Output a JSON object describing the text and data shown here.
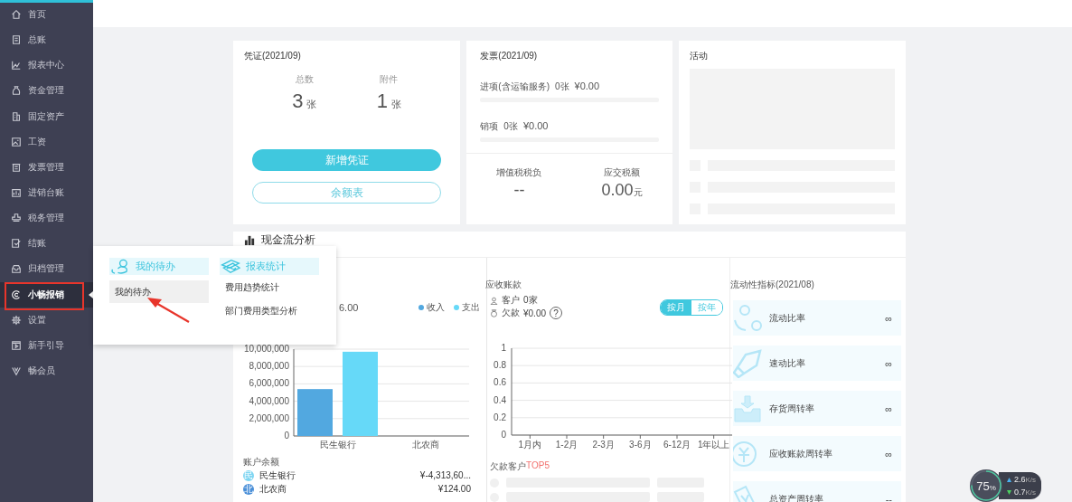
{
  "sidebar": {
    "items": [
      {
        "label": "首页",
        "selected": false
      },
      {
        "label": "总账",
        "selected": false
      },
      {
        "label": "报表中心",
        "selected": false
      },
      {
        "label": "资金管理",
        "selected": false
      },
      {
        "label": "固定资产",
        "selected": false
      },
      {
        "label": "工资",
        "selected": false
      },
      {
        "label": "发票管理",
        "selected": false
      },
      {
        "label": "进销台账",
        "selected": false
      },
      {
        "label": "税务管理",
        "selected": false
      },
      {
        "label": "结账",
        "selected": false
      },
      {
        "label": "归档管理",
        "selected": false
      },
      {
        "label": "小畅报销",
        "selected": true
      },
      {
        "label": "设置",
        "selected": false
      },
      {
        "label": "新手引导",
        "selected": false
      },
      {
        "label": "畅会员",
        "selected": false
      }
    ]
  },
  "popup": {
    "columns": [
      {
        "title": "我的待办",
        "items": [
          {
            "label": "我的待办",
            "selected": true
          }
        ]
      },
      {
        "title": "报表统计",
        "items": [
          {
            "label": "费用趋势统计",
            "selected": false
          },
          {
            "label": "部门费用类型分析",
            "selected": false
          }
        ]
      }
    ]
  },
  "voucher_card": {
    "title": "凭证(2021/09)",
    "stats": [
      {
        "label": "总数",
        "value": "3",
        "unit": "张"
      },
      {
        "label": "附件",
        "value": "1",
        "unit": "张"
      }
    ],
    "primary_button": "新增凭证",
    "secondary_button": "余额表"
  },
  "invoice_card": {
    "title": "发票(2021/09)",
    "lines": [
      {
        "label": "进项(含运输服务)",
        "count": "0张",
        "amount": "¥0.00",
        "level": 0
      },
      {
        "label": "销项",
        "count": "0张",
        "amount": "¥0.00",
        "level": 0
      }
    ],
    "taxes": [
      {
        "label": "增值税税负",
        "value": "--"
      },
      {
        "label": "应交税额",
        "value": "0.00",
        "unit": "元"
      }
    ]
  },
  "activity_card": {
    "title": "活动"
  },
  "cash_flow": {
    "title": "现金流分析",
    "total_fragment": "6.00",
    "chart_data": {
      "type": "bar",
      "grid": true,
      "categories": [
        "民生银行",
        "北农商"
      ],
      "series": [
        {
          "name": "收入",
          "color": "#52a8e0",
          "values": [
            5400000,
            0
          ]
        },
        {
          "name": "支出",
          "color": "#66d9f8",
          "values": [
            9700000,
            0
          ]
        }
      ],
      "ylim": [
        0,
        10000000
      ],
      "yticks": [
        {
          "value": 0,
          "label": "0"
        },
        {
          "value": 2000000,
          "label": "2,000,000"
        },
        {
          "value": 4000000,
          "label": "4,000,000"
        },
        {
          "value": 6000000,
          "label": "6,000,000"
        },
        {
          "value": 8000000,
          "label": "8,000,000"
        },
        {
          "value": 10000000,
          "label": "10,000,000"
        }
      ]
    },
    "balances_title": "账户余额",
    "balances": [
      {
        "badge": "民",
        "name": "民生银行",
        "amount": "¥-4,313,60...",
        "color": "#7fd6f2"
      },
      {
        "badge": "北",
        "name": "北农商",
        "amount": "¥124.00",
        "color": "#4a8fd8"
      }
    ]
  },
  "receivables": {
    "title": "应收账款",
    "customers_label": "客户",
    "customers": "0家",
    "debt_label": "欠款",
    "debt": "¥0.00",
    "help": "?",
    "toggle": [
      {
        "label": "按月",
        "selected": true
      },
      {
        "label": "按年",
        "selected": false
      }
    ],
    "chart_data": {
      "type": "line",
      "grid": true,
      "categories": [
        "1月内",
        "1-2月",
        "2-3月",
        "3-6月",
        "6-12月",
        "1年以上"
      ],
      "ylim": [
        0,
        1
      ],
      "yticks": [
        0,
        0.2,
        0.4,
        0.6,
        0.8,
        1
      ]
    },
    "top_title": "欠款客户",
    "top_highlight": "TOP5"
  },
  "liquidity": {
    "title": "流动性指标(2021/08)",
    "items": [
      {
        "label": "流动比率",
        "value": "∞"
      },
      {
        "label": "速动比率",
        "value": "∞"
      },
      {
        "label": "存货周转率",
        "value": "∞"
      },
      {
        "label": "应收账款周转率",
        "value": "∞"
      },
      {
        "label": "总资产周转率",
        "value": "--"
      }
    ]
  },
  "speed_widget": {
    "percent": "75",
    "percent_unit": "%",
    "up": "2.6",
    "up_unit": "K/s",
    "down": "0.7",
    "down_unit": "K/s"
  }
}
